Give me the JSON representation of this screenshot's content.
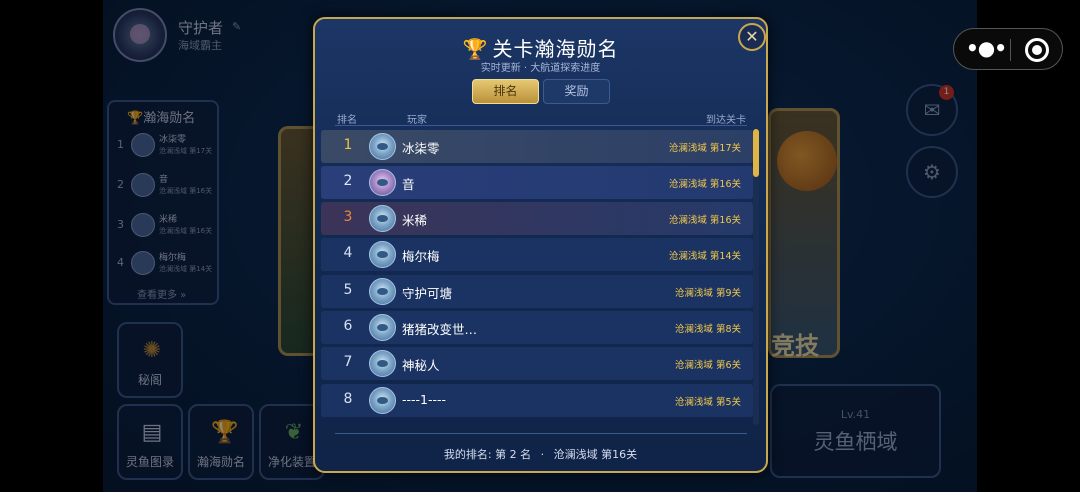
{
  "background": {
    "player": {
      "name": "守护者",
      "title": "海域霸主"
    },
    "rank_panel": {
      "title": "瀚海勋名",
      "rows": [
        {
          "rank": "1",
          "name": "冰柒零",
          "level": "沧澜浅域 第17关"
        },
        {
          "rank": "2",
          "name": "音",
          "level": "沧澜浅域 第16关"
        },
        {
          "rank": "3",
          "name": "米稀",
          "level": "沧澜浅域 第16关"
        },
        {
          "rank": "4",
          "name": "梅尔梅",
          "level": "沧澜浅域 第14关"
        }
      ],
      "more": "查看更多 »"
    },
    "buttons": {
      "secret": "秘阁",
      "fish_book": "灵鱼图录",
      "rank": "瀚海勋名",
      "purify": "净化装置"
    },
    "arena_text": "竞技",
    "mail_badge": "1",
    "realm": {
      "level": "Lv.41",
      "name": "灵鱼栖域"
    }
  },
  "modal": {
    "title": "关卡瀚海勋名",
    "subtitle": "实时更新 · 大航道探索进度",
    "tabs": {
      "rank": "排名",
      "reward": "奖励"
    },
    "headers": {
      "rank": "排名",
      "player": "玩家",
      "level": "到达关卡"
    },
    "rows": [
      {
        "rank": "1",
        "name": "冰柒零",
        "level": "沧澜浅域 第17关"
      },
      {
        "rank": "2",
        "name": "音",
        "level": "沧澜浅域 第16关"
      },
      {
        "rank": "3",
        "name": "米稀",
        "level": "沧澜浅域 第16关"
      },
      {
        "rank": "4",
        "name": "梅尔梅",
        "level": "沧澜浅域 第14关"
      },
      {
        "rank": "5",
        "name": "守护可塘",
        "level": "沧澜浅域 第9关"
      },
      {
        "rank": "6",
        "name": "猪猪改变世…",
        "level": "沧澜浅域 第8关"
      },
      {
        "rank": "7",
        "name": "神秘人",
        "level": "沧澜浅域 第6关"
      },
      {
        "rank": "8",
        "name": "----1----",
        "level": "沧澜浅域 第5关"
      }
    ],
    "footer": {
      "my_rank": "我的排名: 第 2 名",
      "separator": "·",
      "my_level": "沧澜浅域 第16关"
    }
  },
  "icons": {
    "close": "close-icon",
    "trophy": "trophy-icon",
    "mail": "mail-icon",
    "settings": "gear-icon"
  }
}
